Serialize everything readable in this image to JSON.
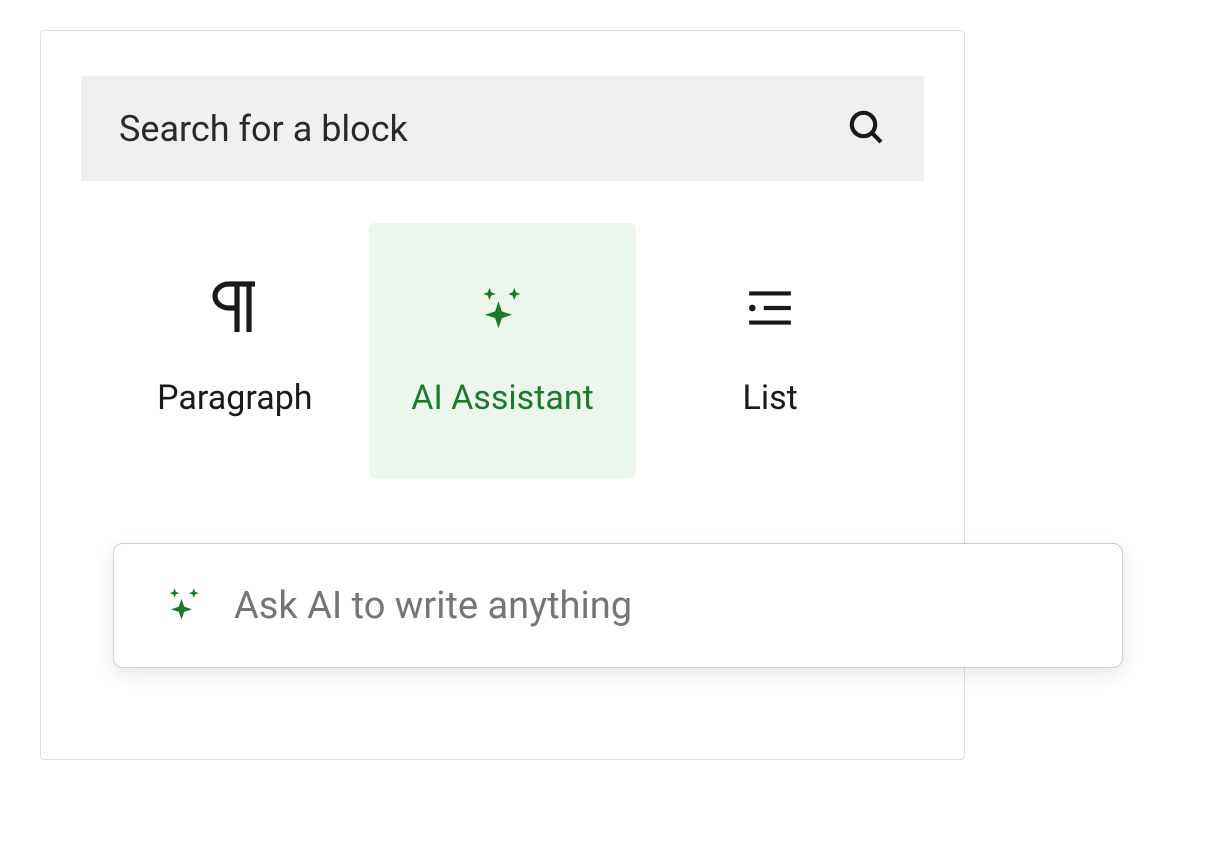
{
  "search": {
    "placeholder": "Search for a block",
    "icon": "search-icon"
  },
  "blocks": {
    "paragraph": {
      "label": "Paragraph",
      "icon": "paragraph-icon",
      "selected": false
    },
    "ai_assistant": {
      "label": "AI Assistant",
      "icon": "sparkles-icon",
      "selected": true
    },
    "list": {
      "label": "List",
      "icon": "list-icon",
      "selected": false
    }
  },
  "ai_prompt": {
    "placeholder": "Ask AI to write anything",
    "icon": "sparkles-icon"
  },
  "colors": {
    "accent_green": "#1b7a2b",
    "selected_bg": "#ebf6ec",
    "search_bg": "#f0f0f0",
    "placeholder_grey": "#757575"
  }
}
